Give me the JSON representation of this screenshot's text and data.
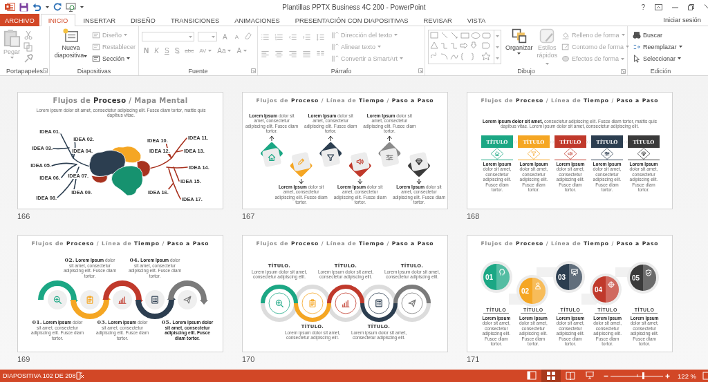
{
  "title_bar": {
    "title": "Plantillas PPTX Business 4C 200 - PowerPoint",
    "help": "?"
  },
  "tabs": [
    {
      "label": "ARCHIVO",
      "kind": "file",
      "selected": false
    },
    {
      "label": "INICIO",
      "kind": "tab",
      "selected": true
    },
    {
      "label": "INSERTAR",
      "kind": "tab",
      "selected": false
    },
    {
      "label": "DISEÑO",
      "kind": "tab",
      "selected": false
    },
    {
      "label": "TRANSICIONES",
      "kind": "tab",
      "selected": false
    },
    {
      "label": "ANIMACIONES",
      "kind": "tab",
      "selected": false
    },
    {
      "label": "PRESENTACIÓN CON DIAPOSITIVAS",
      "kind": "tab",
      "selected": false
    },
    {
      "label": "REVISAR",
      "kind": "tab",
      "selected": false
    },
    {
      "label": "VISTA",
      "kind": "tab",
      "selected": false
    }
  ],
  "account": "Iniciar sesión",
  "ribbon": {
    "groups": [
      {
        "kind": "clipboard",
        "label": "Portapapeles",
        "paste": {
          "label": "Pegar",
          "disabled": true
        }
      },
      {
        "kind": "slides",
        "label": "Diapositivas",
        "new_slide": {
          "label": "Nueva diapositiva",
          "disabled": false
        },
        "items": [
          {
            "label": "Diseño",
            "disabled": true
          },
          {
            "label": "Restablecer",
            "disabled": true
          },
          {
            "label": "Sección",
            "disabled": false
          }
        ]
      },
      {
        "kind": "font",
        "label": "Fuente",
        "size_buttons": [
          {
            "label": "A",
            "disabled": true
          },
          {
            "label": "A",
            "disabled": true
          }
        ],
        "format_buttons": [
          {
            "label": "N",
            "disabled": true
          },
          {
            "label": "K",
            "disabled": true
          },
          {
            "label": "S",
            "disabled": true
          },
          {
            "label": "S",
            "disabled": true
          },
          {
            "label": "abc",
            "disabled": true
          },
          {
            "label": "AV",
            "disabled": true
          },
          {
            "label": "Aa",
            "disabled": true
          },
          {
            "label": "A",
            "disabled": true
          }
        ]
      },
      {
        "kind": "paragraph",
        "label": "Párrafo",
        "items": [
          {
            "label": "Dirección del texto",
            "disabled": true
          },
          {
            "label": "Alinear texto",
            "disabled": true
          },
          {
            "label": "Convertir a SmartArt",
            "disabled": true
          }
        ]
      },
      {
        "kind": "drawing",
        "label": "Dibujo",
        "arrange": {
          "label": "Organizar",
          "disabled": false
        },
        "quick_styles": {
          "label": "Estilos rápidos",
          "disabled": true
        },
        "items": [
          {
            "label": "Relleno de forma",
            "disabled": true
          },
          {
            "label": "Contorno de forma",
            "disabled": true
          },
          {
            "label": "Efectos de forma",
            "disabled": true
          }
        ]
      },
      {
        "kind": "editing",
        "label": "Edición",
        "items": [
          {
            "label": "Buscar",
            "disabled": false
          },
          {
            "label": "Reemplazar",
            "disabled": false
          },
          {
            "label": "Seleccionar",
            "disabled": false
          }
        ]
      }
    ]
  },
  "slides": [
    {
      "kind": "mind_map",
      "number": "166",
      "title": "Flujos de **Proceso** / Mapa Mental",
      "subtitle": "Lorem ipsum dolor sit amet, consectetur adipiscing elit. Fusce diam tortor, mattis quis dapibus vitae.",
      "ideas": [
        "IDEA 01.",
        "IDEA 02.",
        "IDEA 03.",
        "IDEA 04.",
        "IDEA 05.",
        "IDEA 06.",
        "IDEA 07.",
        "IDEA 08.",
        "IDEA 09.",
        "IDEA 10.",
        "IDEA 11.",
        "IDEA 12.",
        "IDEA 13.",
        "IDEA 14.",
        "IDEA 15.",
        "IDEA 16.",
        "IDEA 17."
      ]
    },
    {
      "kind": "tiles",
      "number": "167",
      "title": "Flujos de **Proceso** / Línea de **Tiempo** / **Paso a Paso**",
      "steps": [
        {
          "text": "**Lorem Ipsum** dolor sit amet, consectetur adipiscing elit. Fusce diam tortor.",
          "color": "#1ba784"
        },
        {
          "text": "**Lorem Ipsum** dolor sit amet, consectetur adipiscing elit. Fusce diam tortor.",
          "color": "#f5a623"
        },
        {
          "text": "**Lorem Ipsum** dolor sit amet, consectetur adipiscing elit. Fusce diam tortor.",
          "color": "#2c3e50"
        },
        {
          "text": "**Lorem Ipsum** dolor sit amet, consectetur adipiscing elit. Fusce diam tortor.",
          "color": "#c0392b"
        },
        {
          "text": "**Lorem Ipsum** dolor sit amet, consectetur adipiscing elit. Fusce diam tortor.",
          "color": "#8a8a8a"
        },
        {
          "text": "**Lorem Ipsum** dolor sit amet, consectetur adipiscing elit. Fusce diam tortor.",
          "color": "#3a3a3a"
        }
      ]
    },
    {
      "kind": "columns",
      "number": "168",
      "title": "Flujos de **Proceso** / Línea de **Tiempo** / **Paso a Paso**",
      "intro": "**Lorem ipsum dolor sit amet,** consectetur adipiscing elit. Fusce diam tortor, mattis quis dapibus vitae. Lorem ipsum dolor sit amet, consectetur adipiscing elit.",
      "columns": [
        {
          "title": "TÍTULO",
          "text": "**Lorem Ipsum** dolor sit amet, consectetur adipiscing elit. Fusce diam tortor.",
          "color": "#1ba784"
        },
        {
          "title": "TÍTULO",
          "text": "**Lorem Ipsum** dolor sit amet, consectetur adipiscing elit. Fusce diam tortor.",
          "color": "#f5a623"
        },
        {
          "title": "TÍTULO",
          "text": "**Lorem Ipsum** dolor sit amet, consectetur adipiscing elit. Fusce diam tortor.",
          "color": "#c0392b"
        },
        {
          "title": "TÍTULO",
          "text": "**Lorem Ipsum** dolor sit amet, consectetur adipiscing elit. Fusce diam tortor.",
          "color": "#2c3e50"
        },
        {
          "title": "TÍTULO",
          "text": "**Lorem Ipsum** dolor sit amet, consectetur adipiscing elit. Fusce diam tortor.",
          "color": "#3a3a3a"
        }
      ]
    },
    {
      "kind": "wave",
      "number": "169",
      "title": "Flujos de **Proceso** / Línea de **Tiempo** / **Paso a Paso**",
      "steps": [
        {
          "number": "01.",
          "text": "**Lorem Ipsum** dolor sit amet, consectetur adipiscing elit. Fusce diam tortor.",
          "color": "#1ba784",
          "bold": false
        },
        {
          "number": "02.",
          "text": "**Lorem Ipsum** dolor sit amet, consectetur adipiscing elit. Fusce diam tortor.",
          "color": "#f5a623",
          "bold": false
        },
        {
          "number": "03.",
          "text": "**Lorem Ipsum** dolor sit amet, consectetur adipiscing elit. Fusce diam tortor.",
          "color": "#c0392b",
          "bold": false
        },
        {
          "number": "04.",
          "text": "**Lorem Ipsum** dolor sit amet, consectetur adipiscing elit. Fusce diam tortor.",
          "color": "#2c3e50",
          "bold": false
        },
        {
          "number": "05.",
          "text": "Lorem Ipsum dolor sit amet, consectetur adipiscing elit. Fusce diam tortor.",
          "color": "#7b7b7b",
          "bold": true
        }
      ]
    },
    {
      "kind": "rings",
      "number": "170",
      "title": "Flujos de **Proceso** / Línea de **Tiempo** / **Paso a Paso**",
      "items": [
        {
          "title": "TÍTULO.",
          "text": "Lorem ipsum dolor sit amet, consectetur adipiscing elit.",
          "color": "#1ba784"
        },
        {
          "title": "TÍTULO.",
          "text": "Lorem ipsum dolor sit amet, consectetur adipiscing elit.",
          "color": "#f5a623"
        },
        {
          "title": "TÍTULO.",
          "text": "Lorem ipsum dolor sit amet, consectetur adipiscing elit.",
          "color": "#c0392b"
        },
        {
          "title": "TÍTULO.",
          "text": "Lorem ipsum dolor sit amet, consectetur adipiscing elit.",
          "color": "#2c3e50"
        },
        {
          "title": "TÍTULO.",
          "text": "Lorem ipsum dolor sit amet, consectetur adipiscing elit.",
          "color": "#7b7b7b"
        }
      ]
    },
    {
      "kind": "circles",
      "number": "171",
      "title": "Flujos de **Proceso** / Línea de **Tiempo** / **Paso a Paso**",
      "items": [
        {
          "number": "01",
          "title": "TÍTULO",
          "text": "**Lorem Ipsum** dolor sit amet, consectetur adipiscing elit. Fusce diam tortor.",
          "color": "#1ba784"
        },
        {
          "number": "02",
          "title": "TÍTULO",
          "text": "**Lorem Ipsum** dolor sit amet, consectetur adipiscing elit. Fusce diam tortor.",
          "color": "#f5a623"
        },
        {
          "number": "03",
          "title": "TÍTULO",
          "text": "**Lorem Ipsum** dolor sit amet, consectetur adipiscing elit. Fusce diam tortor.",
          "color": "#2c3e50"
        },
        {
          "number": "04",
          "title": "TÍTULO",
          "text": "**Lorem Ipsum** dolor sit amet, consectetur adipiscing elit. Fusce diam tortor.",
          "color": "#c0392b"
        },
        {
          "number": "05",
          "title": "TÍTULO",
          "text": "**Lorem Ipsum** dolor sit amet, consectetur adipiscing elit. Fusce diam tortor.",
          "color": "#3a3a3a"
        }
      ]
    }
  ],
  "status_bar": {
    "slide_info": "DIAPOSITIVA 102 DE 208",
    "views": [
      {
        "kind": "normal",
        "selected": false
      },
      {
        "kind": "sorter",
        "selected": true
      },
      {
        "kind": "reading",
        "selected": false
      },
      {
        "kind": "show",
        "selected": false
      }
    ],
    "zoom": {
      "level": 0.62,
      "reading": "122 %"
    }
  }
}
